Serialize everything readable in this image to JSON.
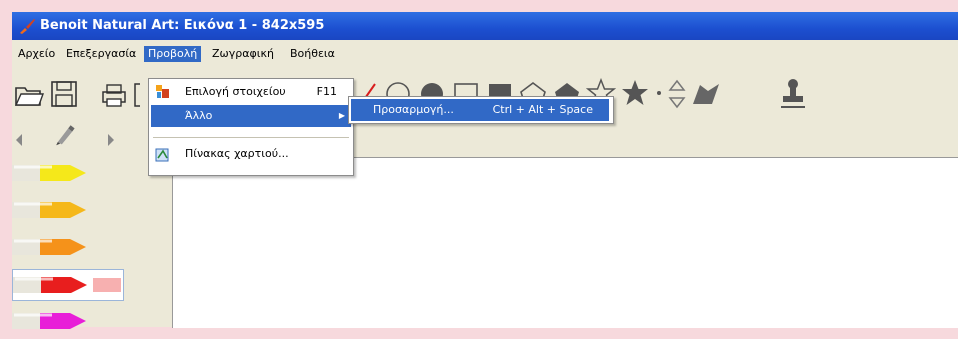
{
  "window": {
    "title": "Benoit Natural Art: Εικόνα 1 - 842x595"
  },
  "menubar": {
    "items": [
      {
        "label": "Αρχείο",
        "active": false
      },
      {
        "label": "Επεξεργασία",
        "active": false
      },
      {
        "label": "Προβολή",
        "active": true
      },
      {
        "label": "Ζωγραφική",
        "active": false
      },
      {
        "label": "Βοήθεια",
        "active": false
      }
    ]
  },
  "dropdown": {
    "items": [
      {
        "icon": "color-picker-icon",
        "label": "Επιλογή στοιχείου",
        "shortcut": "F11"
      },
      {
        "icon": "",
        "label": "Άλλο",
        "shortcut": ""
      },
      {
        "icon": "paper-texture-icon",
        "label": "Πίνακας χαρτιού...",
        "shortcut": ""
      }
    ]
  },
  "submenu": {
    "label": "Προσαρμογή...",
    "shortcut": "Ctrl + Alt + Space"
  },
  "colors": {
    "crayons": [
      "#f5e81a",
      "#f5b81a",
      "#f5921a",
      "#e81e1e",
      "#e81ed8"
    ],
    "accent": "#3169c6",
    "titlebar": "#1c4fd0"
  }
}
